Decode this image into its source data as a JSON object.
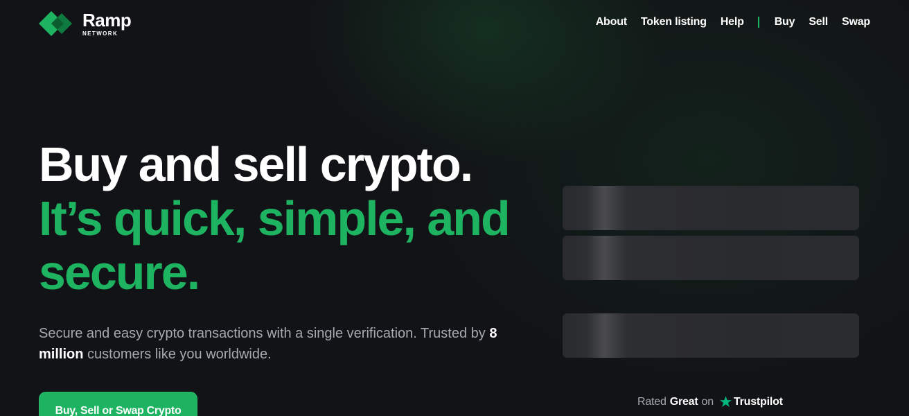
{
  "brand": {
    "name": "Ramp",
    "subtitle": "NETWORK",
    "color": "#1db361"
  },
  "nav": {
    "items": [
      {
        "label": "About"
      },
      {
        "label": "Token listing"
      },
      {
        "label": "Help"
      },
      {
        "label": "Buy"
      },
      {
        "label": "Sell"
      },
      {
        "label": "Swap"
      }
    ]
  },
  "hero": {
    "title_line1": "Buy and sell crypto.",
    "title_line2": "It’s quick, simple, and secure.",
    "desc_before": "Secure and easy crypto transactions with a single verification. Trusted by",
    "desc_highlight": "8 million",
    "desc_after": "customers like you worldwide.",
    "cta_label": "Buy, Sell or Swap Crypto"
  },
  "rating": {
    "prefix": "Rated",
    "grade": "Great",
    "on": "on",
    "provider": "Trustpilot",
    "icon": "trustpilot-star-icon"
  }
}
